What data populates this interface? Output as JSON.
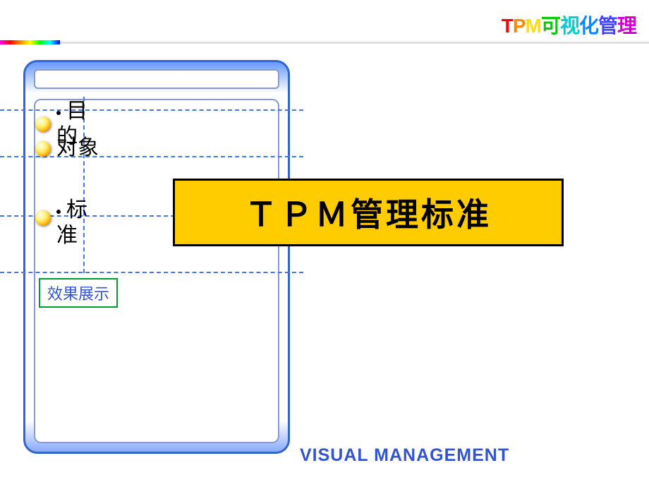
{
  "header": {
    "title_chars": [
      "T",
      "P",
      "M",
      "可",
      "视",
      "化",
      "管",
      "理"
    ]
  },
  "bullets": {
    "item1": "目的",
    "item2": "对象",
    "item3": "标准"
  },
  "section_label": "效果展示",
  "main_title": "ＴＰＭ管理标准",
  "footer": "VISUAL MANAGEMENT"
}
